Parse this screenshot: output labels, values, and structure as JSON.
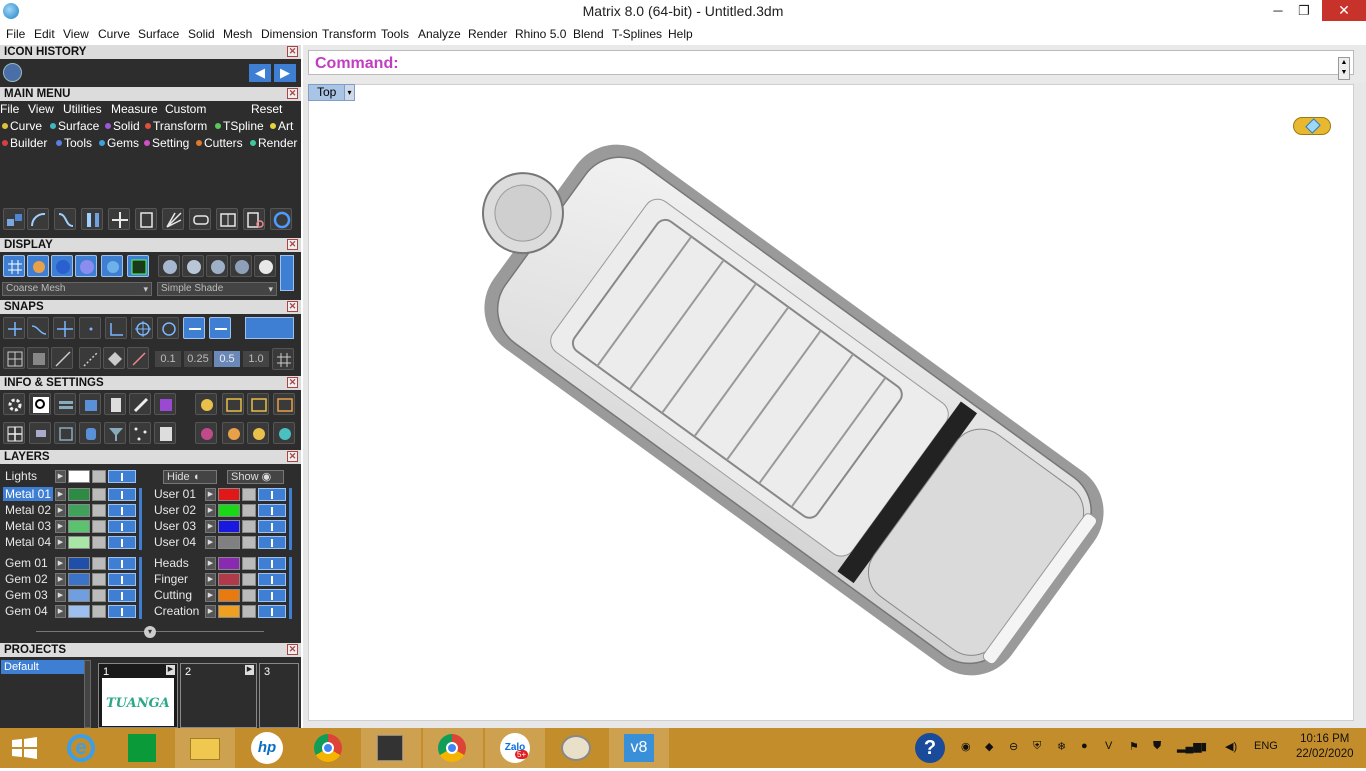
{
  "window": {
    "title": "Matrix 8.0 (64-bit) - Untitled.3dm",
    "minimize": "─",
    "maximize": "❐",
    "close": "✕"
  },
  "menubar": [
    "File",
    "Edit",
    "View",
    "Curve",
    "Surface",
    "Solid",
    "Mesh",
    "Dimension",
    "Transform",
    "Tools",
    "Analyze",
    "Render",
    "Rhino 5.0",
    "Blend",
    "T-Splines",
    "Help"
  ],
  "panels": {
    "icon_history": {
      "title": "ICON HISTORY"
    },
    "main_menu": {
      "title": "MAIN MENU",
      "top_menu": [
        "File",
        "View",
        "Utilities",
        "Measure",
        "Custom"
      ],
      "reset": "Reset",
      "row1": [
        {
          "label": "Curve",
          "color": "#e0c03a"
        },
        {
          "label": "Surface",
          "color": "#3fb7c7"
        },
        {
          "label": "Solid",
          "color": "#9b59d6"
        },
        {
          "label": "Transform",
          "color": "#e0503a"
        },
        {
          "label": "TSpline",
          "color": "#5ac75a"
        },
        {
          "label": "Art",
          "color": "#e8d23c"
        }
      ],
      "row2": [
        {
          "label": "Builder",
          "color": "#d64040"
        },
        {
          "label": "Tools",
          "color": "#5a7fe0"
        },
        {
          "label": "Gems",
          "color": "#3fa0e0"
        },
        {
          "label": "Setting",
          "color": "#d050c8"
        },
        {
          "label": "Cutters",
          "color": "#e07a2a"
        },
        {
          "label": "Render",
          "color": "#3fc7a0"
        }
      ]
    },
    "display": {
      "title": "DISPLAY",
      "mesh_select": "Coarse Mesh",
      "shade_select": "Simple Shade"
    },
    "snaps": {
      "title": "SNAPS",
      "tolerances": [
        "0.1",
        "0.25",
        "0.5",
        "1.0"
      ]
    },
    "info": {
      "title": "INFO & SETTINGS"
    },
    "layers": {
      "title": "LAYERS",
      "lights": "Lights",
      "hide": "Hide",
      "show": "Show",
      "left": [
        {
          "name": "Metal 01",
          "color": "#2e8b45",
          "selected": true
        },
        {
          "name": "Metal 02",
          "color": "#3fa15a"
        },
        {
          "name": "Metal 03",
          "color": "#5bc26f"
        },
        {
          "name": "Metal 04",
          "color": "#a8e6a8"
        },
        {
          "name": "Gem 01",
          "color": "#1f4fa8"
        },
        {
          "name": "Gem 02",
          "color": "#3b73c8"
        },
        {
          "name": "Gem 03",
          "color": "#6f9fe0"
        },
        {
          "name": "Gem 04",
          "color": "#9dbff0"
        }
      ],
      "right": [
        {
          "name": "User 01",
          "color": "#e01818"
        },
        {
          "name": "User 02",
          "color": "#18d818"
        },
        {
          "name": "User 03",
          "color": "#1818e0"
        },
        {
          "name": "User 04",
          "color": "#808080"
        },
        {
          "name": "Heads",
          "color": "#8a2ab0"
        },
        {
          "name": "Finger",
          "color": "#b03a4a"
        },
        {
          "name": "Cutting",
          "color": "#e87a10"
        },
        {
          "name": "Creation",
          "color": "#f0a020"
        }
      ]
    },
    "projects": {
      "title": "PROJECTS",
      "default": "Default",
      "slots": [
        "1",
        "2",
        "3"
      ],
      "thumb_text": "TUANGA"
    }
  },
  "command": {
    "label": "Command:",
    "value": ""
  },
  "viewport": {
    "name": "Top"
  },
  "taskbar": {
    "time": "10:16 PM",
    "date": "22/02/2020",
    "lang": "ENG",
    "zalo_badge": "5+"
  }
}
